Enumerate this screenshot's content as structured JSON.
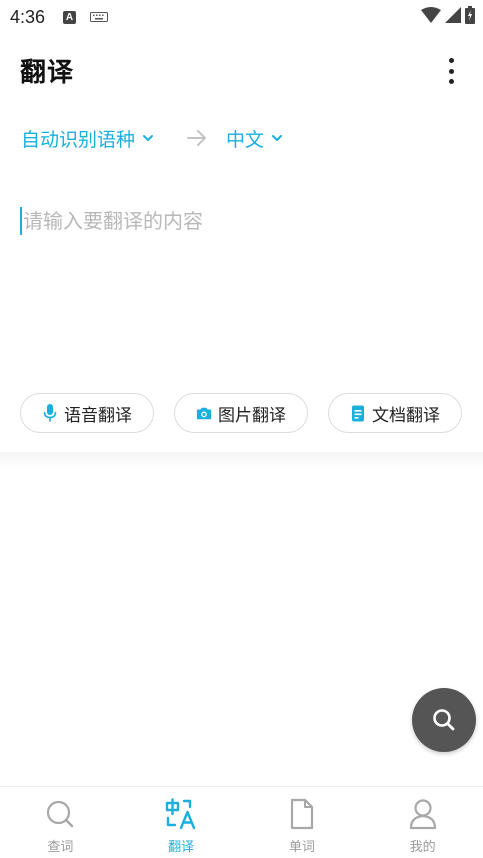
{
  "status_bar": {
    "time": "4:36",
    "a_badge": "A"
  },
  "header": {
    "title": "翻译"
  },
  "languages": {
    "source": "自动识别语种",
    "target": "中文"
  },
  "input": {
    "placeholder": "请输入要翻译的内容"
  },
  "actions": {
    "voice": "语音翻译",
    "image": "图片翻译",
    "document": "文档翻译"
  },
  "bottom_nav": {
    "items": [
      {
        "label": "查词",
        "icon": "search-icon"
      },
      {
        "label": "翻译",
        "icon": "translate-icon"
      },
      {
        "label": "单词",
        "icon": "document-icon"
      },
      {
        "label": "我的",
        "icon": "person-icon"
      }
    ],
    "active_index": 1
  },
  "colors": {
    "accent": "#1ab0de",
    "fab": "#555555",
    "text": "#222222",
    "placeholder": "#b8b8b8"
  }
}
